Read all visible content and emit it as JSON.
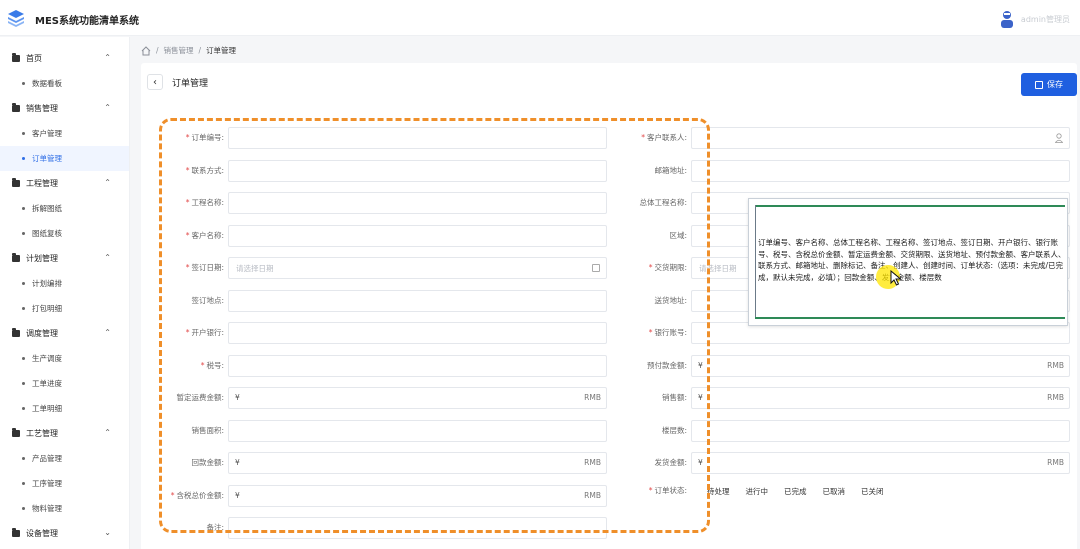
{
  "header": {
    "app_title": "MES系统功能清单系统",
    "user_name": "admin管理员"
  },
  "sidebar": {
    "groups": [
      {
        "label": "首页",
        "items": [
          "数据看板"
        ]
      },
      {
        "label": "销售管理",
        "items": [
          "客户管理",
          "订单管理"
        ]
      },
      {
        "label": "工程管理",
        "items": [
          "拆解图纸",
          "图纸复核"
        ]
      },
      {
        "label": "计划管理",
        "items": [
          "计划编排",
          "打包明细"
        ]
      },
      {
        "label": "调度管理",
        "items": [
          "生产调度",
          "工单进度",
          "工单明细"
        ]
      },
      {
        "label": "工艺管理",
        "items": [
          "产品管理",
          "工序管理",
          "物料管理"
        ]
      },
      {
        "label": "设备管理",
        "items": []
      }
    ],
    "active_item": "订单管理"
  },
  "breadcrumb": {
    "items": [
      "销售管理",
      "订单管理"
    ]
  },
  "page": {
    "title": "订单管理",
    "save_label": "保存"
  },
  "form": {
    "left": [
      {
        "label": "订单编号:",
        "required": true
      },
      {
        "label": "联系方式:",
        "required": true
      },
      {
        "label": "工程名称:",
        "required": true
      },
      {
        "label": "客户名称:",
        "required": true
      },
      {
        "label": "签订日期:",
        "required": true,
        "placeholder": "请选择日期"
      },
      {
        "label": "签订地点:",
        "required": false
      },
      {
        "label": "开户银行:",
        "required": true
      },
      {
        "label": "税号:",
        "required": true
      },
      {
        "label": "暂定运费金额:",
        "required": false,
        "prefix": "¥",
        "suffix": "RMB"
      },
      {
        "label": "销售面积:",
        "required": false
      },
      {
        "label": "回款金额:",
        "required": false,
        "prefix": "¥",
        "suffix": "RMB"
      },
      {
        "label": "含税总价金额:",
        "required": true,
        "prefix": "¥",
        "suffix": "RMB"
      },
      {
        "label": "备注:",
        "required": false
      }
    ],
    "right": [
      {
        "label": "客户联系人:",
        "required": true
      },
      {
        "label": "邮箱地址:",
        "required": false
      },
      {
        "label": "总体工程名称:",
        "required": false
      },
      {
        "label": "区域:",
        "required": false
      },
      {
        "label": "交货期限:",
        "required": true,
        "placeholder": "请选择日期"
      },
      {
        "label": "送货地址:",
        "required": false
      },
      {
        "label": "银行账号:",
        "required": true
      },
      {
        "label": "预付款金额:",
        "required": false,
        "prefix": "¥",
        "suffix": "RMB"
      },
      {
        "label": "销售额:",
        "required": false,
        "prefix": "¥",
        "suffix": "RMB"
      },
      {
        "label": "楼层数:",
        "required": false
      },
      {
        "label": "发货金额:",
        "required": false,
        "prefix": "¥",
        "suffix": "RMB"
      }
    ],
    "status": {
      "label": "订单状态:",
      "required": true,
      "options": [
        "待处理",
        "进行中",
        "已完成",
        "已取消",
        "已关闭"
      ]
    }
  },
  "popup": {
    "text": "订单编号、客户名称、总体工程名称、工程名称、签订地点、签订日期、开户银行、银行账号、税号、含税总价金额、暂定运费金额、交货期限、送货地址、预付款金额、客户联系人、联系方式、邮箱地址、删除标记、备注、创建人、创建时间、订单状态:（选项：未完成/已完成，默认未完成，必填）；回款金额、发货金额、楼层数"
  },
  "colors": {
    "primary": "#1f5fe0",
    "highlight": "#ef8f2a",
    "required": "#e24848"
  }
}
